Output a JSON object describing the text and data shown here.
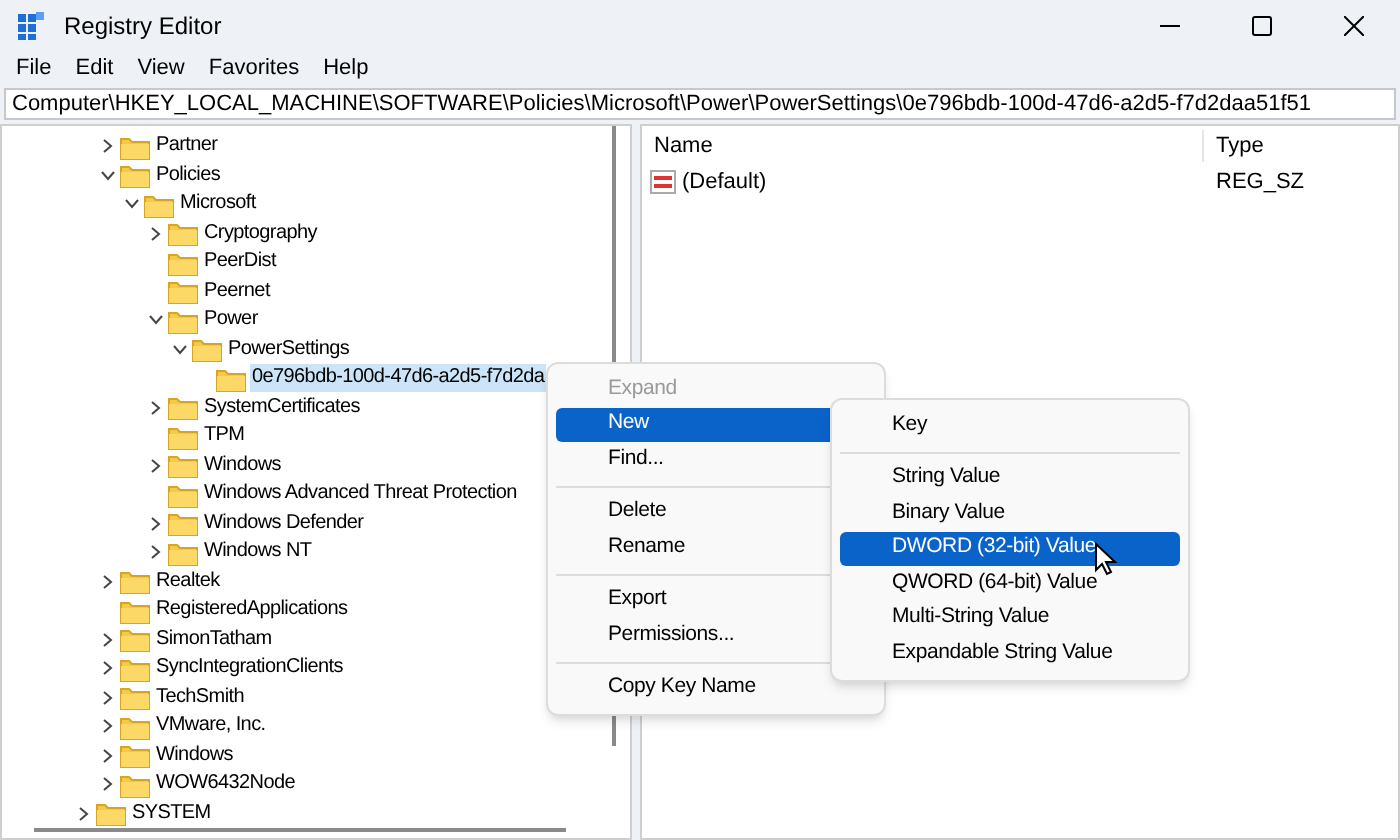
{
  "window": {
    "title": "Registry Editor"
  },
  "menu_bar": [
    "File",
    "Edit",
    "View",
    "Favorites",
    "Help"
  ],
  "address": "Computer\\HKEY_LOCAL_MACHINE\\SOFTWARE\\Policies\\Microsoft\\Power\\PowerSettings\\0e796bdb-100d-47d6-a2d5-f7d2daa51f51",
  "tree": [
    {
      "children": [
        {
          "label": "Partner",
          "expanded": false,
          "selected": false
        },
        {
          "label": "Policies",
          "expanded": true,
          "selected": false,
          "children": [
            {
              "label": "Microsoft",
              "expanded": true,
              "selected": false,
              "children": [
                {
                  "label": "Cryptography",
                  "expanded": false,
                  "selected": false
                },
                {
                  "label": "PeerDist",
                  "selected": false
                },
                {
                  "label": "Peernet",
                  "selected": false
                },
                {
                  "label": "Power",
                  "expanded": true,
                  "selected": false,
                  "children": [
                    {
                      "label": "PowerSettings",
                      "expanded": true,
                      "selected": false,
                      "children": [
                        {
                          "label": "0e796bdb-100d-47d6-a2d5-f7d2da",
                          "selected": true
                        }
                      ]
                    }
                  ]
                },
                {
                  "label": "SystemCertificates",
                  "expanded": false,
                  "selected": false
                },
                {
                  "label": "TPM",
                  "selected": false
                },
                {
                  "label": "Windows",
                  "expanded": false,
                  "selected": false
                },
                {
                  "label": "Windows Advanced Threat Protection",
                  "selected": false
                },
                {
                  "label": "Windows Defender",
                  "expanded": false,
                  "selected": false
                },
                {
                  "label": "Windows NT",
                  "expanded": false,
                  "selected": false
                }
              ]
            }
          ]
        },
        {
          "label": "Realtek",
          "expanded": false,
          "selected": false
        },
        {
          "label": "RegisteredApplications",
          "selected": false
        },
        {
          "label": "SimonTatham",
          "expanded": false,
          "selected": false
        },
        {
          "label": "SyncIntegrationClients",
          "expanded": false,
          "selected": false
        },
        {
          "label": "TechSmith",
          "expanded": false,
          "selected": false
        },
        {
          "label": "VMware, Inc.",
          "expanded": false,
          "selected": false
        },
        {
          "label": "Windows",
          "expanded": false,
          "selected": false
        },
        {
          "label": "WOW6432Node",
          "expanded": false,
          "selected": false
        }
      ]
    },
    {
      "label": "SYSTEM",
      "expanded": false,
      "selected": false
    }
  ],
  "values": {
    "columns": [
      "Name",
      "Type"
    ],
    "rows": [
      {
        "name": "(Default)",
        "type": "REG_SZ"
      }
    ]
  },
  "context_menu": [
    {
      "kind": "item",
      "label": "Expand",
      "disabled": true,
      "selected": false
    },
    {
      "kind": "submenu",
      "label": "New",
      "disabled": false,
      "selected": true
    },
    {
      "kind": "item",
      "label": "Find...",
      "disabled": false,
      "selected": false
    },
    {
      "kind": "separator"
    },
    {
      "kind": "item",
      "label": "Delete",
      "disabled": false,
      "selected": false
    },
    {
      "kind": "item",
      "label": "Rename",
      "disabled": false,
      "selected": false
    },
    {
      "kind": "separator"
    },
    {
      "kind": "item",
      "label": "Export",
      "disabled": false,
      "selected": false
    },
    {
      "kind": "item",
      "label": "Permissions...",
      "disabled": false,
      "selected": false
    },
    {
      "kind": "separator"
    },
    {
      "kind": "item",
      "label": "Copy Key Name",
      "disabled": false,
      "selected": false
    }
  ],
  "new_submenu": [
    {
      "kind": "item",
      "label": "Key",
      "selected": false
    },
    {
      "kind": "separator"
    },
    {
      "kind": "item",
      "label": "String Value",
      "selected": false
    },
    {
      "kind": "item",
      "label": "Binary Value",
      "selected": false
    },
    {
      "kind": "item",
      "label": "DWORD (32-bit) Value",
      "selected": true
    },
    {
      "kind": "item",
      "label": "QWORD (64-bit) Value",
      "selected": false
    },
    {
      "kind": "item",
      "label": "Multi-String Value",
      "selected": false
    },
    {
      "kind": "item",
      "label": "Expandable String Value",
      "selected": false
    }
  ]
}
